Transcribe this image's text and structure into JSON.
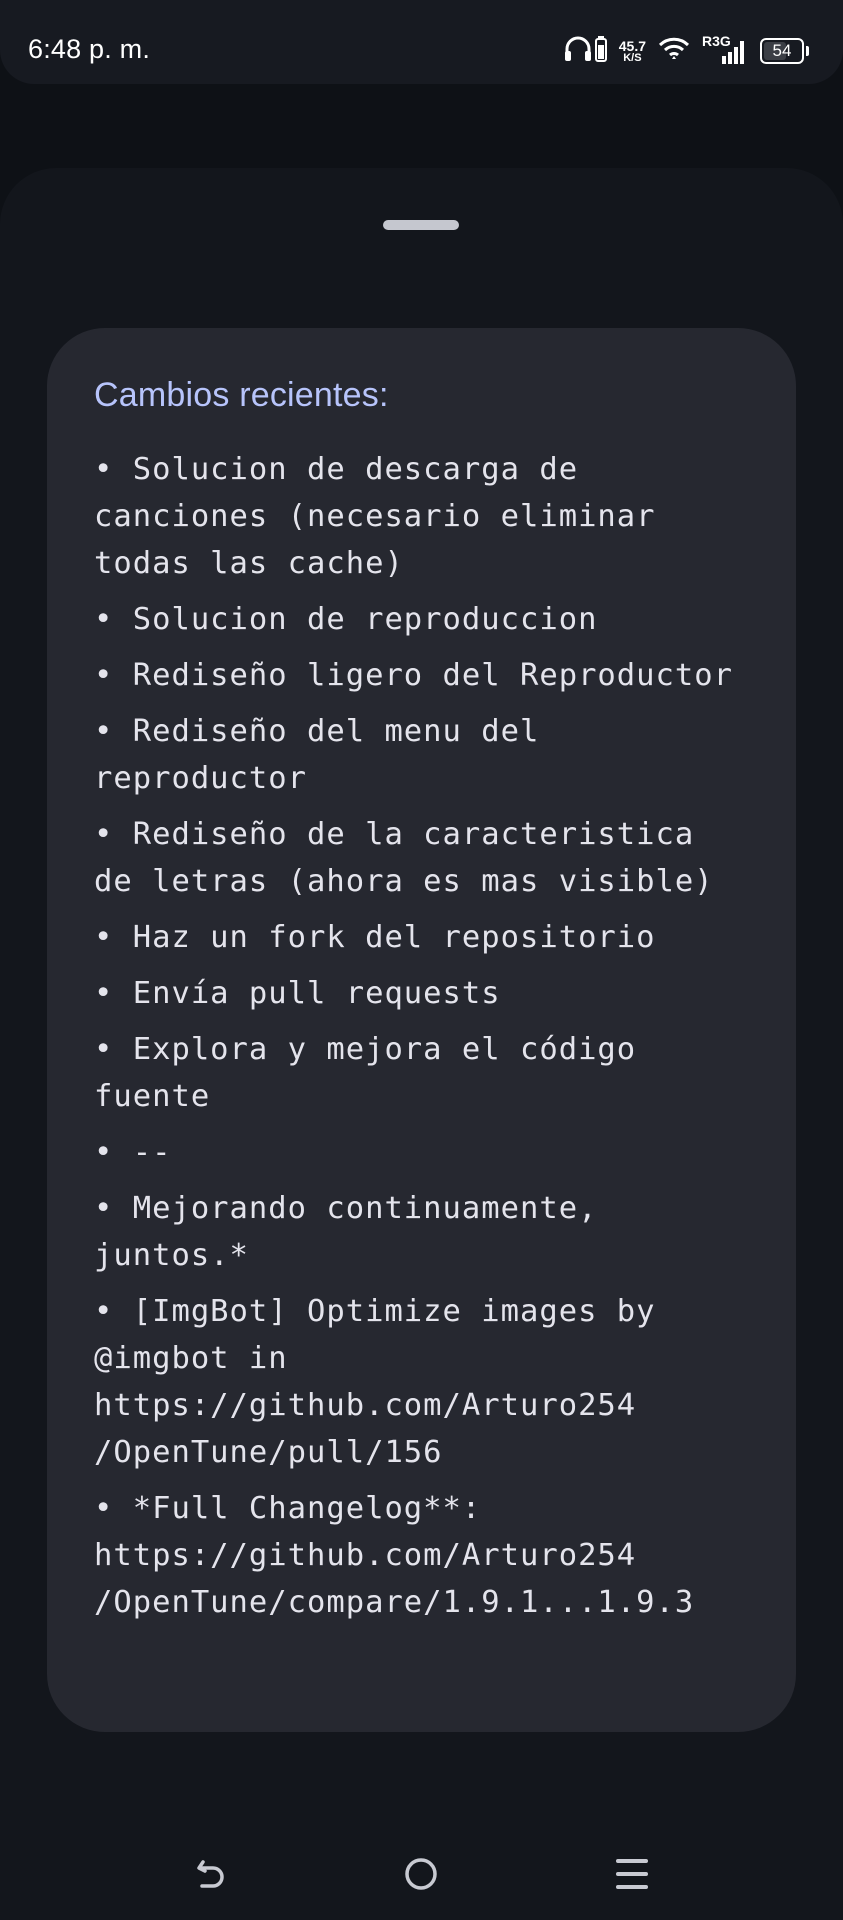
{
  "status_bar": {
    "time": "6:48 p. m.",
    "network_speed_value": "45.7",
    "network_speed_unit": "K/S",
    "signal_label": "R3G",
    "battery_level": "54",
    "battery_fraction": 0.54,
    "icons": [
      "headphones-icon",
      "battery-small-icon",
      "wifi-icon",
      "signal-icon",
      "battery-icon"
    ]
  },
  "sheet": {
    "card": {
      "title": "Cambios recientes:",
      "items": [
        "• Solucion de descarga de canciones (necesario eliminar todas las cache)",
        "• Solucion de reproduccion",
        "• Rediseño ligero del Reproductor",
        "• Rediseño del menu del reproductor",
        "• Rediseño de la caracteristica de letras (ahora es mas visible)",
        "• Haz un fork del repositorio",
        "• Envía pull requests",
        "• Explora y mejora el código fuente",
        "• --",
        "• Mejorando continuamente, juntos.*",
        "• [ImgBot] Optimize images by @imgbot in https://github.com/Arturo254\n/OpenTune/pull/156",
        "• *Full Changelog**: https://github.com/Arturo254\n/OpenTune/compare/1.9.1...1.9.3"
      ]
    }
  },
  "nav_bar": {
    "icons": [
      "back-icon",
      "home-icon",
      "menu-icon"
    ]
  },
  "colors": {
    "background": "#0e1116",
    "status_bar": "#171a21",
    "sheet": "#13161c",
    "card": "#262830",
    "title_accent": "#b7c4fb",
    "text": "#e4e4ec"
  }
}
